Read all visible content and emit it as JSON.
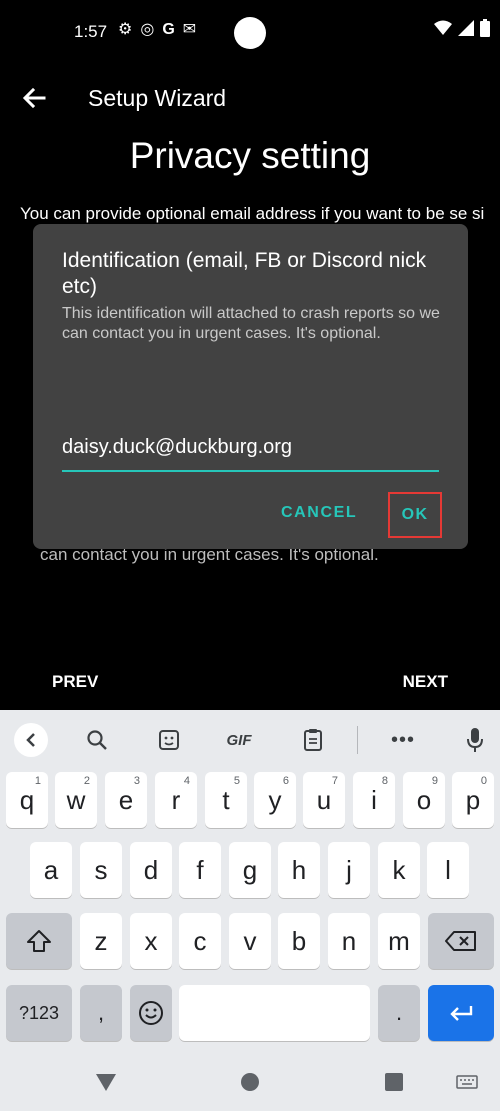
{
  "status_bar": {
    "time": "1:57",
    "left_icons": [
      "gear-icon",
      "sync-icon",
      "google-icon",
      "gmail-icon"
    ],
    "right_icons": [
      "wifi-icon",
      "signal-icon",
      "battery-icon"
    ]
  },
  "app_bar": {
    "title": "Setup Wizard"
  },
  "page": {
    "title": "Privacy setting",
    "intro_text": "You can provide optional email address if you want to be se si",
    "under_text": "can contact you in urgent cases. It's optional."
  },
  "dialog": {
    "title": "Identification (email, FB or Discord nick etc)",
    "message": "This identification will attached to crash reports so we can contact you in urgent cases. It's optional.",
    "input_value": "daisy.duck@duckburg.org",
    "cancel_label": "CANCEL",
    "ok_label": "OK"
  },
  "navigation": {
    "prev_label": "PREV",
    "next_label": "NEXT"
  },
  "keyboard": {
    "toolbar_gif": "GIF",
    "row1": [
      {
        "key": "q",
        "hint": "1"
      },
      {
        "key": "w",
        "hint": "2"
      },
      {
        "key": "e",
        "hint": "3"
      },
      {
        "key": "r",
        "hint": "4"
      },
      {
        "key": "t",
        "hint": "5"
      },
      {
        "key": "y",
        "hint": "6"
      },
      {
        "key": "u",
        "hint": "7"
      },
      {
        "key": "i",
        "hint": "8"
      },
      {
        "key": "o",
        "hint": "9"
      },
      {
        "key": "p",
        "hint": "0"
      }
    ],
    "row2": [
      "a",
      "s",
      "d",
      "f",
      "g",
      "h",
      "j",
      "k",
      "l"
    ],
    "row3": [
      "z",
      "x",
      "c",
      "v",
      "b",
      "n",
      "m"
    ],
    "symbols_label": "?123",
    "comma_label": ",",
    "period_label": "."
  },
  "colors": {
    "accent": "#26c6b9",
    "highlight": "#e53935",
    "enter": "#1a73e8",
    "dialog_bg": "#424242"
  }
}
